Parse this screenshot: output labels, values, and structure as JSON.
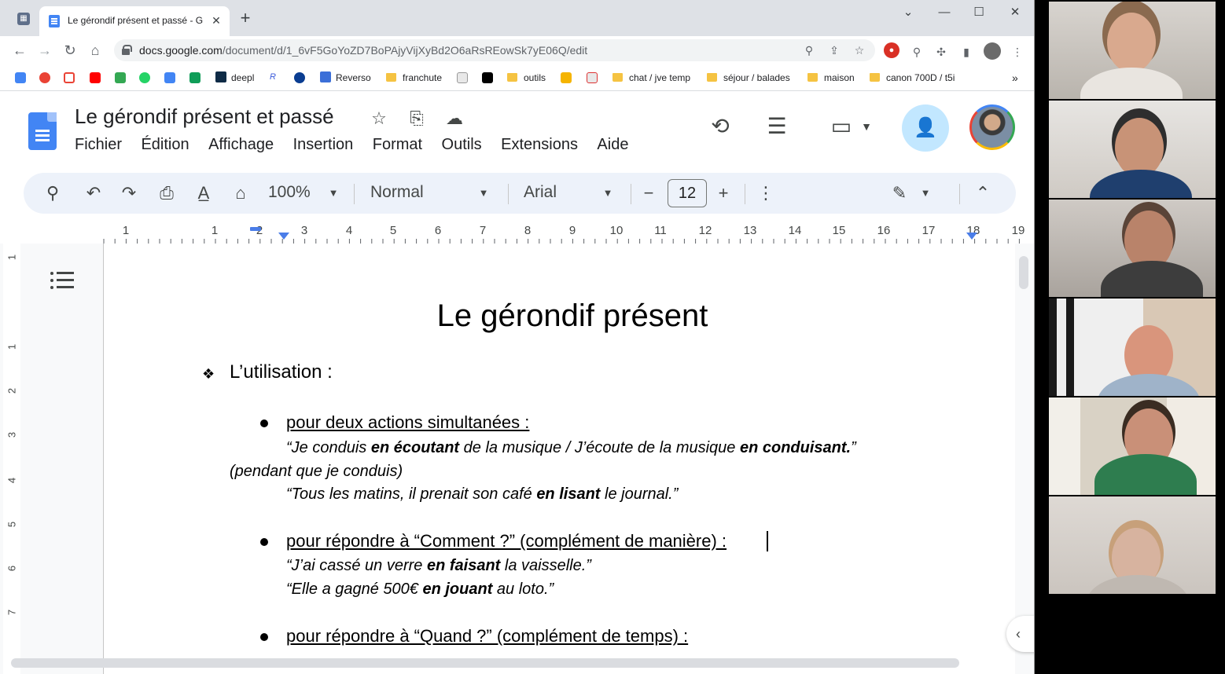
{
  "browser": {
    "tab_title": "Le gérondif présent et passé - G",
    "tab_close": "✕",
    "new_tab": "+",
    "url_host": "docs.google.com",
    "url_path": "/document/d/1_6vF5GoYoZD7BoPAjyVijXyBd2O6aRsREowSk7yE06Q/edit",
    "bookmarks": [
      "deepl",
      "Reverso",
      "franchute",
      "outils",
      "chat / jve temp",
      "séjour / balades",
      "maison",
      "canon 700D / t5i"
    ]
  },
  "docs": {
    "title": "Le gérondif présent et passé",
    "menu": [
      "Fichier",
      "Édition",
      "Affichage",
      "Insertion",
      "Format",
      "Outils",
      "Extensions",
      "Aide"
    ],
    "toolbar": {
      "zoom": "100%",
      "style": "Normal",
      "font": "Arial",
      "font_size": "12"
    },
    "ruler_numbers": [
      "1",
      "1",
      "2",
      "3",
      "4",
      "5",
      "6",
      "7",
      "8",
      "9",
      "10",
      "11",
      "12",
      "13",
      "14",
      "15",
      "16",
      "17",
      "18",
      "19"
    ],
    "vruler_numbers": [
      "1",
      "1",
      "2",
      "3",
      "4",
      "5",
      "6",
      "7"
    ],
    "content": {
      "heading": "Le gérondif présent",
      "section": "L’utilisation :",
      "bullet1": "pour deux actions simultanées :",
      "ex1_a": "“Je conduis ",
      "ex1_b": "en écoutant",
      "ex1_c": " de la musique / J’écoute de la musique ",
      "ex1_d": "en conduisant.",
      "ex1_e": "”",
      "ex1_note": "(pendant que je conduis)",
      "ex2_a": "“Tous les matins, il prenait son café ",
      "ex2_b": "en lisant",
      "ex2_c": " le journal.”",
      "bullet2": "pour répondre à “Comment ?” (complément de manière) :",
      "ex3_a": "“J’ai cassé un verre ",
      "ex3_b": "en faisant",
      "ex3_c": " la vaisselle.”",
      "ex4_a": "“Elle a gagné 500€ ",
      "ex4_b": "en jouant",
      "ex4_c": " au loto.”",
      "bullet3": "pour répondre à “Quand ?” (complément de temps) :"
    }
  },
  "icons": {
    "back": "arrow-left-icon",
    "forward": "arrow-right-icon",
    "reload": "reload-icon",
    "home": "home-icon",
    "star": "star-icon",
    "history": "history-icon",
    "comments": "comment-icon",
    "meet": "video-camera-icon",
    "share": "add-person-icon"
  },
  "colors": {
    "docs_blue": "#4285f4",
    "share_bg": "#c2e7ff",
    "toolbar_bg": "#edf2fa",
    "tabstrip_bg": "#dee1e6"
  }
}
